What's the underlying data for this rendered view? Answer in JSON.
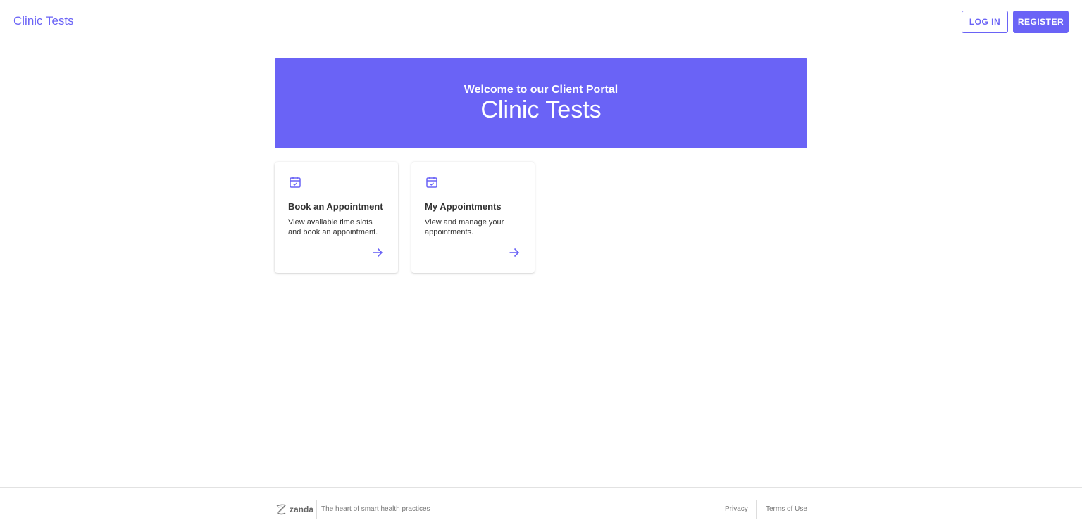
{
  "header": {
    "brand": "Clinic Tests",
    "login_label": "LOG IN",
    "register_label": "REGISTER"
  },
  "hero": {
    "subtitle": "Welcome to our Client Portal",
    "title": "Clinic Tests"
  },
  "cards": [
    {
      "icon": "calendar-check-icon",
      "title": "Book an Appointment",
      "description": "View available time slots and book an appointment."
    },
    {
      "icon": "calendar-check-icon",
      "title": "My Appointments",
      "description": "View and manage your appointments."
    }
  ],
  "footer": {
    "logo_text": "zanda",
    "tagline": "The heart of smart health practices",
    "privacy_label": "Privacy",
    "terms_label": "Terms of Use"
  },
  "colors": {
    "accent": "#6a63f6"
  }
}
